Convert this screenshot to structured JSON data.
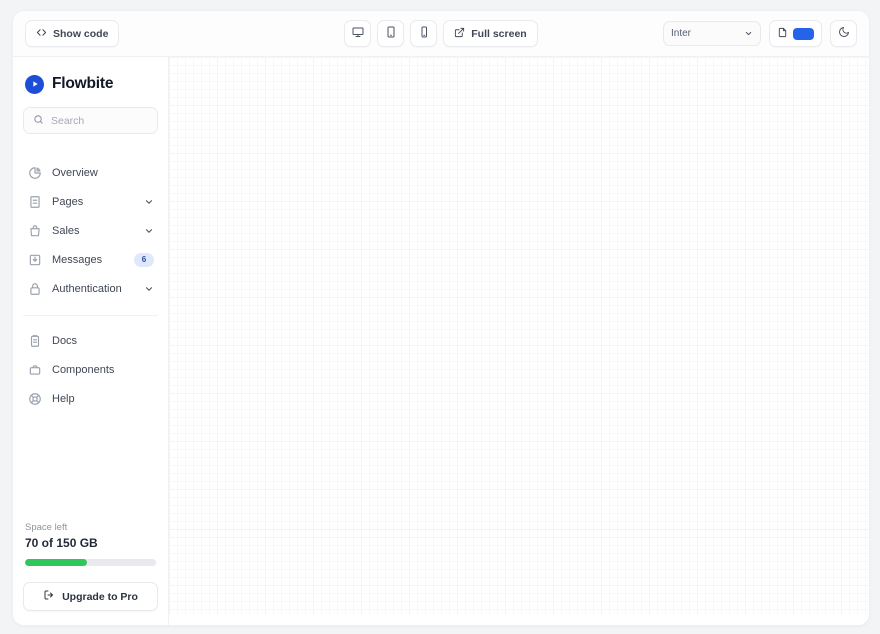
{
  "toolbar": {
    "show_code_label": "Show code",
    "show_code_icon": "code-brackets-icon",
    "viewport_buttons": [
      {
        "name": "desktop",
        "icon": "desktop-icon"
      },
      {
        "name": "tablet",
        "icon": "tablet-icon"
      },
      {
        "name": "mobile",
        "icon": "mobile-icon"
      }
    ],
    "fullscreen_label": "Full screen",
    "fullscreen_icon": "external-link-icon",
    "font_select_value": "Inter",
    "font_select_options": [
      "Inter"
    ],
    "theme_color": "#2563eb",
    "color_picker_icon": "palette-page-icon",
    "dark_mode_icon": "moon-icon"
  },
  "sidebar": {
    "brand": {
      "name": "Flowbite",
      "logo_icon": "flowbite-play-logo"
    },
    "search": {
      "placeholder": "Search",
      "value": "",
      "icon": "search-icon"
    },
    "primary_items": [
      {
        "label": "Overview",
        "icon": "chart-pie-icon",
        "chevron": false,
        "badge": ""
      },
      {
        "label": "Pages",
        "icon": "document-icon",
        "chevron": true,
        "badge": ""
      },
      {
        "label": "Sales",
        "icon": "shopping-bag-icon",
        "chevron": true,
        "badge": ""
      },
      {
        "label": "Messages",
        "icon": "inbox-download-icon",
        "chevron": false,
        "badge": "6"
      },
      {
        "label": "Authentication",
        "icon": "lock-icon",
        "chevron": true,
        "badge": ""
      }
    ],
    "secondary_items": [
      {
        "label": "Docs",
        "icon": "clipboard-icon"
      },
      {
        "label": "Components",
        "icon": "briefcase-icon"
      },
      {
        "label": "Help",
        "icon": "lifebuoy-icon"
      }
    ],
    "storage": {
      "title": "Space left",
      "value": "70 of 150 GB",
      "percent": 47,
      "bar_color": "#31c65c"
    },
    "upgrade": {
      "label": "Upgrade to Pro",
      "icon": "logout-arrow-icon"
    }
  },
  "canvas": {
    "label": "component-preview-canvas",
    "grid": "dotted-grid"
  }
}
